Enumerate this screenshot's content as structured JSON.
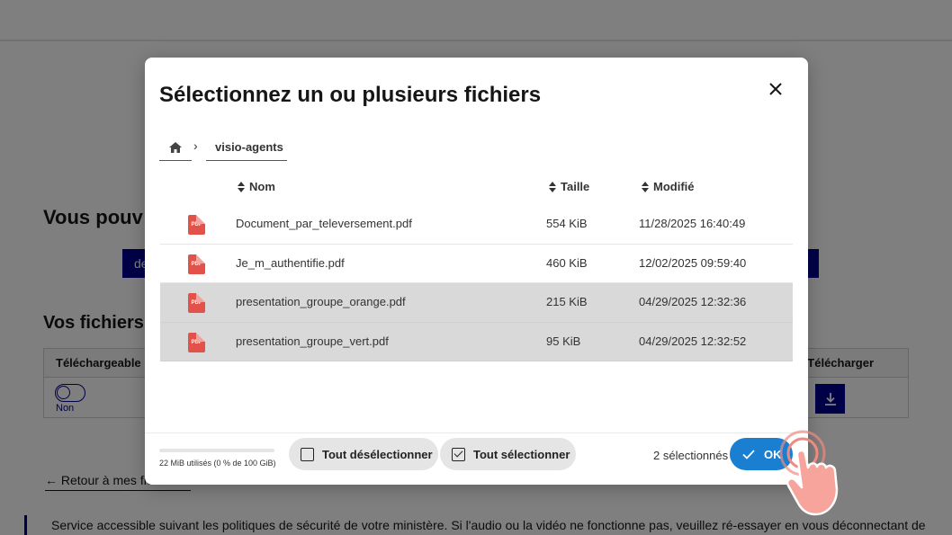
{
  "background": {
    "heading": "Vous pouv",
    "button_left_label": "de",
    "files_title": "Vos fichiers",
    "table_col_left": "Téléchargeable",
    "table_col_right": "Télécharger",
    "toggle_label": "Non",
    "back_link": "Retour à mes fichiers",
    "notice": "Service accessible suivant les politiques de sécurité de votre ministère. Si l'audio ou la vidéo ne fonctionne pas, veuillez ré-essayer en vous déconnectant de"
  },
  "dialog": {
    "title": "Sélectionnez un ou plusieurs fichiers",
    "breadcrumb": {
      "home_icon": "home-icon",
      "folder": "visio-agents"
    },
    "columns": {
      "name": "Nom",
      "size": "Taille",
      "modified": "Modifié"
    },
    "files": [
      {
        "name": "Document_par_televersement.pdf",
        "size": "554 KiB",
        "modified": "11/28/2025 16:40:49",
        "selected": false,
        "icon_text": "PDF"
      },
      {
        "name": "Je_m_authentifie.pdf",
        "size": "460 KiB",
        "modified": "12/02/2025 09:59:40",
        "selected": false,
        "icon_text": "PDF"
      },
      {
        "name": "presentation_groupe_orange.pdf",
        "size": "215 KiB",
        "modified": "04/29/2025 12:32:36",
        "selected": true,
        "icon_text": "PDF"
      },
      {
        "name": "presentation_groupe_vert.pdf",
        "size": "95 KiB",
        "modified": "04/29/2025 12:32:52",
        "selected": true,
        "icon_text": "PDF"
      }
    ],
    "footer": {
      "storage_text": "22 MiB utilisés (0 % de 100 GiB)",
      "storage_fraction": 0.0,
      "deselect_all": "Tout désélectionner",
      "select_all": "Tout sélectionner",
      "selected_count": "2 sélectionnés",
      "ok": "OK"
    }
  },
  "colors": {
    "primary_blue": "#000091",
    "ok_button": "#1a7fd0",
    "pdf_red": "#e2514a",
    "selected_row": "#d9d9d9",
    "tap_indicator": "#f08a80"
  }
}
